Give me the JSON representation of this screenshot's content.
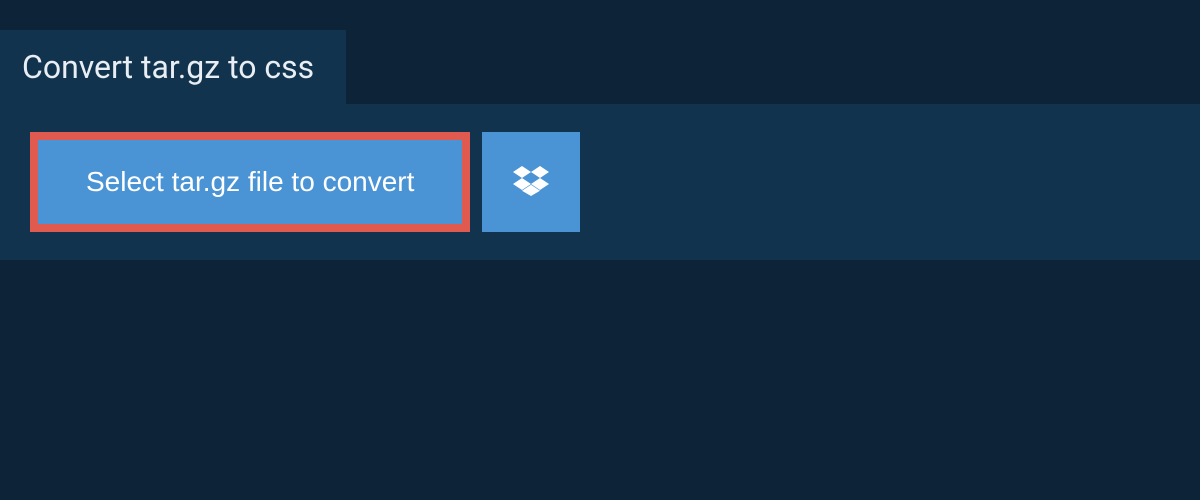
{
  "header": {
    "title": "Convert tar.gz to css"
  },
  "main": {
    "select_button_label": "Select tar.gz file to convert"
  },
  "colors": {
    "background_dark": "#0d2438",
    "panel": "#12334d",
    "button_blue": "#4a94d6",
    "highlight_border": "#e05a4f",
    "text_light": "#e8eef3",
    "text_white": "#ffffff"
  }
}
